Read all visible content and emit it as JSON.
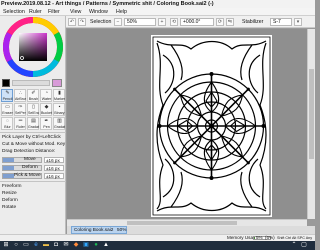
{
  "window": {
    "title": "Preview.2019.08.12 - Art things / Patterns / Symmetric shit / Coloring Book.sai2 (-)"
  },
  "menu": [
    "Selection",
    "Ruler",
    "Filter",
    "View",
    "Window",
    "Help"
  ],
  "toolbar": {
    "selection_label": "Selection",
    "zoom_value": "50%",
    "angle_value": "+000.0°",
    "stabilizer_label": "Stabilizer",
    "stabilizer_value": "S-7"
  },
  "leftpanel": {
    "tool_rows": [
      [
        "Pencil",
        "AirBrush",
        "Brush",
        "Water",
        "Marker"
      ],
      [
        "Eraser",
        "SelPen",
        "SelErase",
        "Bucket",
        "Binary"
      ],
      [
        "Blur",
        "Ruler",
        "Gradat.",
        "Pen",
        "Gradat."
      ]
    ],
    "selected_tool_index": 0,
    "options": {
      "pick_layer": "Pick Layer by Ctrl+LeftClick",
      "cut_move": "Cut & Move without Mod. Key",
      "drag_detection": "Drag Detection Distance:",
      "move_label": "Move",
      "move_value": "±16 px",
      "deform_label": "Deform",
      "deform_value": "±16 px",
      "pick_move_label": "Pick & Move",
      "pick_move_value": "±16 px",
      "freeform": "Freeform",
      "resize": "Resize",
      "deform": "Deform",
      "rotate": "Rotate"
    }
  },
  "document": {
    "tab_label": "Coloring Book.sai2",
    "zoom": "50%"
  },
  "status": {
    "memory_label": "Memory Usage",
    "memory_value": "5%",
    "memory_extra": "(6%)",
    "mode": "Shift Ctrl Alt SPC Any"
  },
  "taskbar": {
    "icons": [
      "windows-icon",
      "search-icon",
      "task-view-icon",
      "browser-icon",
      "folder-icon",
      "store-icon",
      "mail-icon",
      "sai-app-icon",
      "photoshop-icon",
      "music-icon",
      "game-icon"
    ]
  },
  "colors": {
    "accent": "#6d9ed4",
    "taskbar": "#1f2d3d"
  }
}
